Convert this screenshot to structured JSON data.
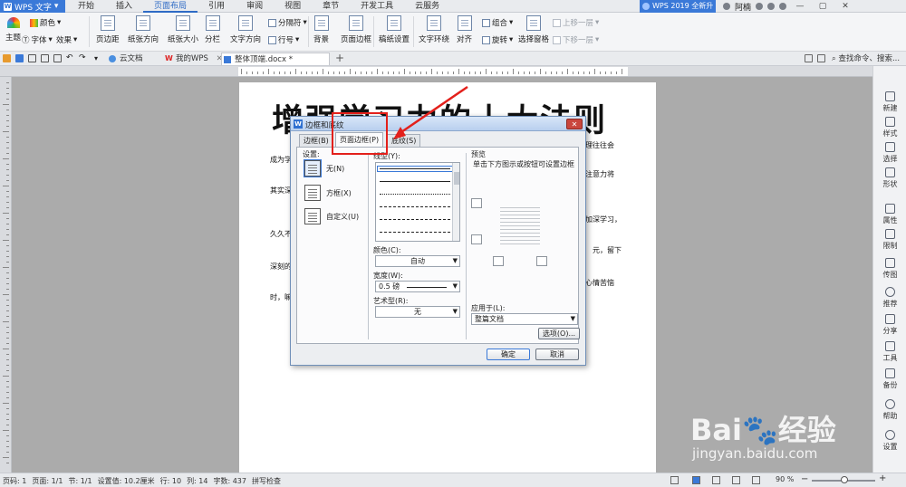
{
  "app": {
    "name": "WPS 文字",
    "upgrade": "WPS 2019 全新升级",
    "user": "阿楠"
  },
  "menu_tabs": [
    "开始",
    "插入",
    "页面布局",
    "引用",
    "审阅",
    "视图",
    "章节",
    "开发工具",
    "云服务"
  ],
  "ribbon": {
    "theme": "主题",
    "color": "颜色",
    "font": "字体",
    "effects": "效果",
    "margins": "页边距",
    "orientation": "纸张方向",
    "size": "纸张大小",
    "columns": "分栏",
    "text_direction": "文字方向",
    "breaks": "分隔符",
    "line_numbers": "行号",
    "background": "背景",
    "page_border": "页面边框",
    "paper_setup": "稿纸设置",
    "text_wrap": "文字环绕",
    "align": "对齐",
    "group": "组合",
    "rotate": "旋转",
    "selection_pane": "选择窗格",
    "bring_forward": "上移一层",
    "send_backward": "下移一层"
  },
  "doc_tabs": [
    "云文档",
    "我的WPS",
    "整体顶端.docx *"
  ],
  "search_cmd": "查找命令、搜索...",
  "document": {
    "title": "增强学习力的十大法则",
    "left_fragments": [
      "成为学",
      "其实深",
      "久久不",
      "深刻的",
      "时，嘛"
    ],
    "right_fragments": [
      "理往往会",
      "注意力将",
      "加深学习，",
      "元，留下",
      "心情苦恼"
    ]
  },
  "sidebar": [
    "新建",
    "样式",
    "选择",
    "形状",
    "属性",
    "限制",
    "传图",
    "推荐",
    "分享",
    "工具",
    "备份",
    "帮助",
    "设置"
  ],
  "status": {
    "page_no": "页码: 1",
    "pages": "页面: 1/1",
    "section": "节: 1/1",
    "setting": "设置值: 10.2厘米",
    "row": "行: 10",
    "col": "列: 14",
    "words": "字数: 437",
    "spell": "拼写检查",
    "zoom": "90 %"
  },
  "dialog": {
    "title": "边框和底纹",
    "close": "✕",
    "tabs": [
      "边框(B)",
      "页面边框(P)",
      "底纹(S)"
    ],
    "active_tab": 1,
    "setting_label": "设置:",
    "settings": [
      "无(N)",
      "方框(X)",
      "自定义(U)"
    ],
    "line_style_label": "线型(Y):",
    "color_label": "颜色(C):",
    "color_value": "自动",
    "width_label": "宽度(W):",
    "width_value": "0.5 磅",
    "art_label": "艺术型(R):",
    "art_value": "无",
    "preview_label": "预览",
    "preview_hint": "单击下方图示或按钮可设置边框",
    "apply_label": "应用于(L):",
    "apply_value": "整篇文档",
    "options": "选项(O)...",
    "ok": "确定",
    "cancel": "取消"
  },
  "watermark": {
    "main": "Bai🐾经验",
    "sub": "jingyan.baidu.com"
  },
  "colors": {
    "accent": "#3a79d8",
    "annotation": "#e3201b"
  }
}
